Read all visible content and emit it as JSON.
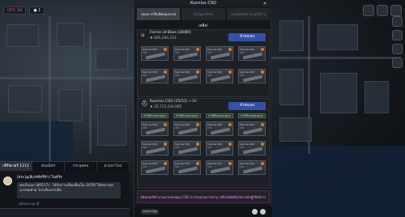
{
  "modal": {
    "title": "Kunnius CSO",
    "close_label": "×",
    "tabs": [
      {
        "label": "สอนการใช้แพ็คคอุปกรณ์",
        "active": true
      },
      {
        "label": "Assign Here",
        "active": false
      },
      {
        "label": "แบบรีคอร์ดจำนวนใช้งาน",
        "active": false
      }
    ],
    "section_label": "เหลือ!",
    "packs": [
      {
        "icon": "home-icon",
        "name": "Forces at Base (28/80)",
        "price": "♦ 695,290,333",
        "bonus": "",
        "button_label": "ทำต่อเลย",
        "cards": [
          {
            "name": "Kunnius CSO",
            "qty": "333"
          },
          {
            "name": "Kunnius CSO",
            "qty": "333"
          },
          {
            "name": "Kunnius CSO",
            "qty": "333"
          },
          {
            "name": "Kunnius CSO",
            "qty": "333"
          },
          {
            "name": "Kunnius CSO",
            "qty": "333"
          },
          {
            "name": "Kunnius CSO",
            "qty": "333"
          },
          {
            "name": "Kunnius CSO",
            "qty": "333"
          },
          {
            "name": "Kunnius CSO",
            "qty": "333"
          }
        ]
      },
      {
        "icon": "helmet-icon",
        "name": "Kunnius CSO (25/51)",
        "price": "♦ 25,723,244,985",
        "bonus": "+16",
        "button_label": "ทำต่อเลย",
        "chips": [
          "ทำให้ทั้งหมดของทุกคน",
          "ทำให้ทั้งหมดของทุกคน",
          "ทำให้ทั้งหมดของทุกคน",
          "ทำให้ทั้งหมดของทุกคน"
        ],
        "cards": [
          {
            "name": "Kunnius CSO",
            "qty": "333"
          },
          {
            "name": "Kunnius CSO",
            "qty": "333"
          },
          {
            "name": "Kunnius CSO",
            "qty": "333"
          },
          {
            "name": "Kunnius CSO",
            "qty": "333"
          },
          {
            "name": "Kunnius CSO",
            "qty": "333"
          },
          {
            "name": "Kunnius CSO",
            "qty": "333"
          },
          {
            "name": "Kunnius CSO",
            "qty": "333"
          },
          {
            "name": "Kunnius CSO",
            "qty": "333"
          },
          {
            "name": "Kunnius CSO",
            "qty": "333"
          },
          {
            "name": "Kunnius CSO",
            "qty": "333"
          },
          {
            "name": "Kunnius CSO",
            "qty": "333"
          },
          {
            "name": "Kunnius CSO",
            "qty": "333"
          }
        ]
      }
    ],
    "footer_note": "ผลิตภัณฑ์จำนวนมากของคุณ CSO หากไม่ถอนการบำรุง หรือไม่ตัดสินใจร่วมกับผู้ใช้บริการ",
    "language_button": "Quick Ops"
  },
  "chat": {
    "tabs": [
      {
        "label": "เซิร์ฟเวอร์ 1213",
        "active": true
      },
      {
        "label": "พันธมิตร",
        "active": false
      },
      {
        "label": "กระบุคคล",
        "active": false
      },
      {
        "label": "ตามหาโลก",
        "active": false
      }
    ],
    "sender": "[ยระ]@ลิเบรท์ทรี่ฟ้า] วินด์ร์ร",
    "message": "พลเรือเอก (80517) : ได้รับการเลื่อนขั้นเป็น SCPO ให้ทหารทุกนายชมด้วย โปรเสียงปรบมือ",
    "time": "เมื่อไม่นานมานี้"
  },
  "hud": {
    "left_chips": [
      "(83) 3d",
      "● 1"
    ],
    "colors": {
      "accent": "#3550a6",
      "bonus": "#f1c24c",
      "alert": "#e05050"
    }
  }
}
